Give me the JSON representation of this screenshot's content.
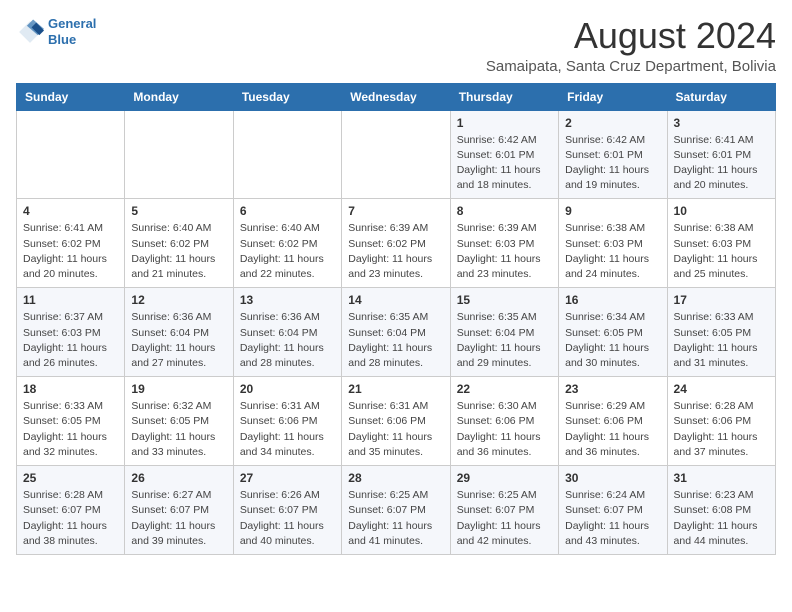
{
  "logo": {
    "line1": "General",
    "line2": "Blue"
  },
  "title": "August 2024",
  "subtitle": "Samaipata, Santa Cruz Department, Bolivia",
  "weekdays": [
    "Sunday",
    "Monday",
    "Tuesday",
    "Wednesday",
    "Thursday",
    "Friday",
    "Saturday"
  ],
  "weeks": [
    [
      {
        "day": "",
        "info": ""
      },
      {
        "day": "",
        "info": ""
      },
      {
        "day": "",
        "info": ""
      },
      {
        "day": "",
        "info": ""
      },
      {
        "day": "1",
        "info": "Sunrise: 6:42 AM\nSunset: 6:01 PM\nDaylight: 11 hours and 18 minutes."
      },
      {
        "day": "2",
        "info": "Sunrise: 6:42 AM\nSunset: 6:01 PM\nDaylight: 11 hours and 19 minutes."
      },
      {
        "day": "3",
        "info": "Sunrise: 6:41 AM\nSunset: 6:01 PM\nDaylight: 11 hours and 20 minutes."
      }
    ],
    [
      {
        "day": "4",
        "info": "Sunrise: 6:41 AM\nSunset: 6:02 PM\nDaylight: 11 hours and 20 minutes."
      },
      {
        "day": "5",
        "info": "Sunrise: 6:40 AM\nSunset: 6:02 PM\nDaylight: 11 hours and 21 minutes."
      },
      {
        "day": "6",
        "info": "Sunrise: 6:40 AM\nSunset: 6:02 PM\nDaylight: 11 hours and 22 minutes."
      },
      {
        "day": "7",
        "info": "Sunrise: 6:39 AM\nSunset: 6:02 PM\nDaylight: 11 hours and 23 minutes."
      },
      {
        "day": "8",
        "info": "Sunrise: 6:39 AM\nSunset: 6:03 PM\nDaylight: 11 hours and 23 minutes."
      },
      {
        "day": "9",
        "info": "Sunrise: 6:38 AM\nSunset: 6:03 PM\nDaylight: 11 hours and 24 minutes."
      },
      {
        "day": "10",
        "info": "Sunrise: 6:38 AM\nSunset: 6:03 PM\nDaylight: 11 hours and 25 minutes."
      }
    ],
    [
      {
        "day": "11",
        "info": "Sunrise: 6:37 AM\nSunset: 6:03 PM\nDaylight: 11 hours and 26 minutes."
      },
      {
        "day": "12",
        "info": "Sunrise: 6:36 AM\nSunset: 6:04 PM\nDaylight: 11 hours and 27 minutes."
      },
      {
        "day": "13",
        "info": "Sunrise: 6:36 AM\nSunset: 6:04 PM\nDaylight: 11 hours and 28 minutes."
      },
      {
        "day": "14",
        "info": "Sunrise: 6:35 AM\nSunset: 6:04 PM\nDaylight: 11 hours and 28 minutes."
      },
      {
        "day": "15",
        "info": "Sunrise: 6:35 AM\nSunset: 6:04 PM\nDaylight: 11 hours and 29 minutes."
      },
      {
        "day": "16",
        "info": "Sunrise: 6:34 AM\nSunset: 6:05 PM\nDaylight: 11 hours and 30 minutes."
      },
      {
        "day": "17",
        "info": "Sunrise: 6:33 AM\nSunset: 6:05 PM\nDaylight: 11 hours and 31 minutes."
      }
    ],
    [
      {
        "day": "18",
        "info": "Sunrise: 6:33 AM\nSunset: 6:05 PM\nDaylight: 11 hours and 32 minutes."
      },
      {
        "day": "19",
        "info": "Sunrise: 6:32 AM\nSunset: 6:05 PM\nDaylight: 11 hours and 33 minutes."
      },
      {
        "day": "20",
        "info": "Sunrise: 6:31 AM\nSunset: 6:06 PM\nDaylight: 11 hours and 34 minutes."
      },
      {
        "day": "21",
        "info": "Sunrise: 6:31 AM\nSunset: 6:06 PM\nDaylight: 11 hours and 35 minutes."
      },
      {
        "day": "22",
        "info": "Sunrise: 6:30 AM\nSunset: 6:06 PM\nDaylight: 11 hours and 36 minutes."
      },
      {
        "day": "23",
        "info": "Sunrise: 6:29 AM\nSunset: 6:06 PM\nDaylight: 11 hours and 36 minutes."
      },
      {
        "day": "24",
        "info": "Sunrise: 6:28 AM\nSunset: 6:06 PM\nDaylight: 11 hours and 37 minutes."
      }
    ],
    [
      {
        "day": "25",
        "info": "Sunrise: 6:28 AM\nSunset: 6:07 PM\nDaylight: 11 hours and 38 minutes."
      },
      {
        "day": "26",
        "info": "Sunrise: 6:27 AM\nSunset: 6:07 PM\nDaylight: 11 hours and 39 minutes."
      },
      {
        "day": "27",
        "info": "Sunrise: 6:26 AM\nSunset: 6:07 PM\nDaylight: 11 hours and 40 minutes."
      },
      {
        "day": "28",
        "info": "Sunrise: 6:25 AM\nSunset: 6:07 PM\nDaylight: 11 hours and 41 minutes."
      },
      {
        "day": "29",
        "info": "Sunrise: 6:25 AM\nSunset: 6:07 PM\nDaylight: 11 hours and 42 minutes."
      },
      {
        "day": "30",
        "info": "Sunrise: 6:24 AM\nSunset: 6:07 PM\nDaylight: 11 hours and 43 minutes."
      },
      {
        "day": "31",
        "info": "Sunrise: 6:23 AM\nSunset: 6:08 PM\nDaylight: 11 hours and 44 minutes."
      }
    ]
  ]
}
